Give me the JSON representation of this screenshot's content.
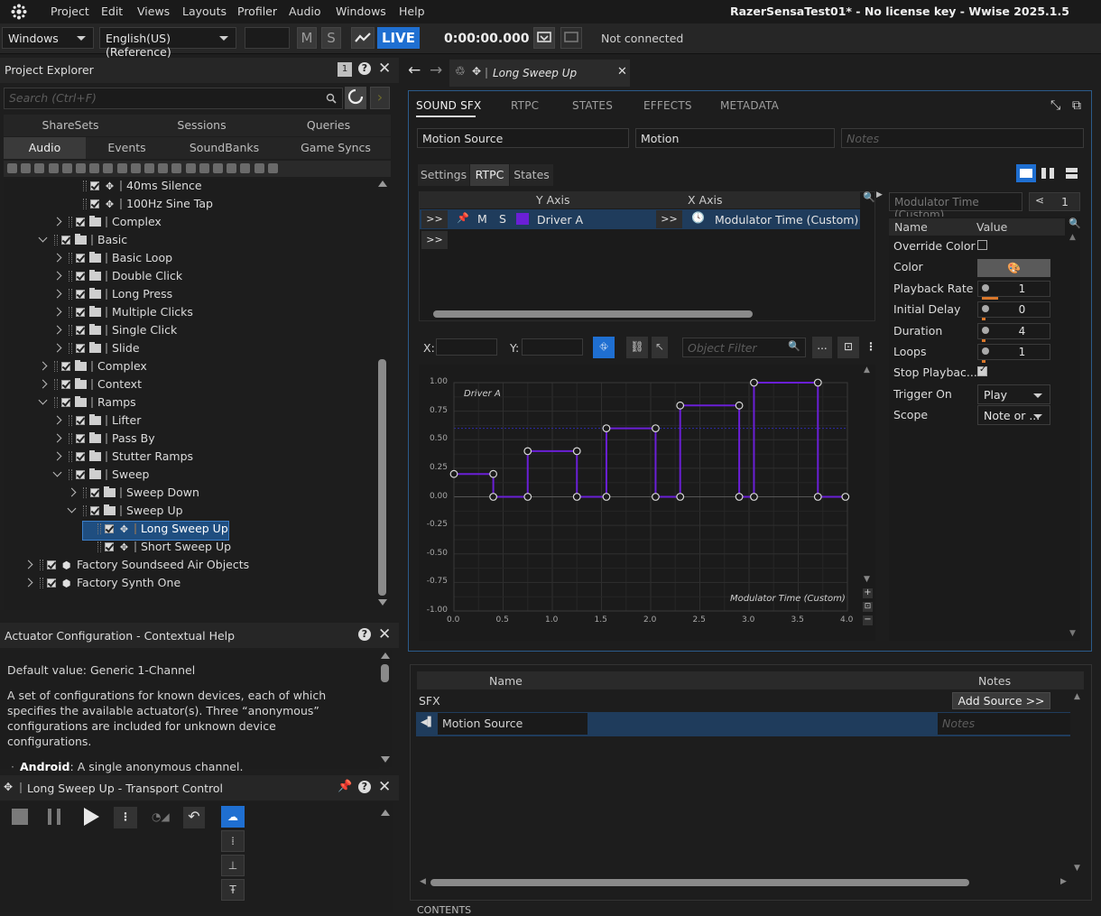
{
  "menu": {
    "items": [
      "Project",
      "Edit",
      "Views",
      "Layouts",
      "Profiler",
      "Audio",
      "Windows",
      "Help"
    ],
    "window_title": "RazerSensaTest01* - No license key - Wwise 2025.1.5"
  },
  "toolbar": {
    "platform": "Windows",
    "language": "English(US) (Reference)",
    "mute_label": "M",
    "solo_label": "S",
    "live_label": "LIVE",
    "time": "0:00:00.000",
    "connection_status": "Not connected"
  },
  "project_explorer": {
    "title": "Project Explorer",
    "badge": "1",
    "search_placeholder": "Search (Ctrl+F)",
    "tabs_top": [
      "ShareSets",
      "Sessions",
      "Queries"
    ],
    "tabs_bottom": [
      "Audio",
      "Events",
      "SoundBanks",
      "Game Syncs"
    ],
    "tree": [
      {
        "label": "40ms Silence",
        "kind": "sfx",
        "indent": 3,
        "expander": ""
      },
      {
        "label": "100Hz Sine Tap",
        "kind": "sfx",
        "indent": 3,
        "expander": ""
      },
      {
        "label": "Complex",
        "kind": "folder",
        "indent": 2,
        "expander": "right"
      },
      {
        "label": "Basic",
        "kind": "folder",
        "indent": 1,
        "expander": "down"
      },
      {
        "label": "Basic Loop",
        "kind": "folder",
        "indent": 2,
        "expander": "right"
      },
      {
        "label": "Double Click",
        "kind": "folder",
        "indent": 2,
        "expander": "right"
      },
      {
        "label": "Long Press",
        "kind": "folder",
        "indent": 2,
        "expander": "right"
      },
      {
        "label": "Multiple Clicks",
        "kind": "folder",
        "indent": 2,
        "expander": "right"
      },
      {
        "label": "Single Click",
        "kind": "folder",
        "indent": 2,
        "expander": "right"
      },
      {
        "label": "Slide",
        "kind": "folder",
        "indent": 2,
        "expander": "right"
      },
      {
        "label": "Complex",
        "kind": "folder",
        "indent": 1,
        "expander": "right"
      },
      {
        "label": "Context",
        "kind": "folder",
        "indent": 1,
        "expander": "right"
      },
      {
        "label": "Ramps",
        "kind": "folder",
        "indent": 1,
        "expander": "down"
      },
      {
        "label": "Lifter",
        "kind": "folder",
        "indent": 2,
        "expander": "right"
      },
      {
        "label": "Pass By",
        "kind": "folder",
        "indent": 2,
        "expander": "right"
      },
      {
        "label": "Stutter Ramps",
        "kind": "folder",
        "indent": 2,
        "expander": "right"
      },
      {
        "label": "Sweep",
        "kind": "folder",
        "indent": 2,
        "expander": "down"
      },
      {
        "label": "Sweep Down",
        "kind": "folder",
        "indent": 3,
        "expander": "right"
      },
      {
        "label": "Sweep Up",
        "kind": "folder",
        "indent": 3,
        "expander": "down"
      },
      {
        "label": "Long Sweep Up",
        "kind": "sfx",
        "indent": 4,
        "expander": "",
        "selected": true
      },
      {
        "label": "Short Sweep Up",
        "kind": "sfx",
        "indent": 4,
        "expander": ""
      },
      {
        "label": "Factory Soundseed Air Objects",
        "kind": "package",
        "indent": 0,
        "expander": "right"
      },
      {
        "label": "Factory Synth One",
        "kind": "package",
        "indent": 0,
        "expander": "right"
      }
    ]
  },
  "help_panel": {
    "title": "Actuator Configuration - Contextual Help",
    "default_value": "Default value: Generic 1-Channel",
    "description": "A set of configurations for known devices, each of which specifies the available actuator(s). Three “anonymous” configurations are included for unknown device configurations.",
    "bullet_term": "Android",
    "bullet_text": ": A single anonymous channel."
  },
  "transport": {
    "title": "Long Sweep Up - Transport Control"
  },
  "editor": {
    "tab_title": "Long Sweep Up",
    "tabs": [
      "SOUND SFX",
      "RTPC",
      "STATES",
      "EFFECTS",
      "METADATA"
    ],
    "name_value": "Motion Source",
    "type_value": "Motion",
    "notes_placeholder": "Notes",
    "subtabs": [
      "Settings",
      "RTPC",
      "States"
    ],
    "rtpc_headers": {
      "y_axis": "Y Axis",
      "x_axis": "X Axis"
    },
    "rtpc_row": {
      "expand": ">>",
      "m": "M",
      "s": "S",
      "y_value": "Driver A",
      "x_expand": ">>",
      "x_value": "Modulator Time (Custom)"
    },
    "rtpc_row2_expand": ">>",
    "x_label": "X:",
    "y_label": "Y:",
    "object_filter_placeholder": "Object Filter",
    "more_label": "...",
    "modulator_field": "Modulator Time (Custom)",
    "count": "1",
    "props_header": {
      "name": "Name",
      "value": "Value"
    },
    "props": [
      {
        "name": "Override Color",
        "type": "check",
        "checked": false
      },
      {
        "name": "Color",
        "type": "color"
      },
      {
        "name": "Playback Rate",
        "type": "slider",
        "value": "1"
      },
      {
        "name": "Initial Delay",
        "type": "slider",
        "value": "0"
      },
      {
        "name": "Duration",
        "type": "slider",
        "value": "4"
      },
      {
        "name": "Loops",
        "type": "slider",
        "value": "1"
      },
      {
        "name": "Stop Playbac...",
        "type": "check",
        "checked": true
      },
      {
        "name": "Trigger On",
        "type": "combo",
        "value": "Play"
      },
      {
        "name": "Scope",
        "type": "combo",
        "value": "Note or ..."
      }
    ]
  },
  "chart_data": {
    "type": "line",
    "title": "",
    "series": [
      {
        "name": "Driver A",
        "x": [
          0,
          0.4,
          0.4,
          0.75,
          0.75,
          1.25,
          1.25,
          1.55,
          1.55,
          2.05,
          2.05,
          2.3,
          2.3,
          2.9,
          2.9,
          3.05,
          3.05,
          3.7,
          3.7,
          3.98
        ],
        "y": [
          0.2,
          0.2,
          0,
          0,
          0.4,
          0.4,
          0,
          0,
          0.6,
          0.6,
          0,
          0,
          0.8,
          0.8,
          0,
          0,
          1,
          1,
          0,
          0
        ]
      }
    ],
    "series_label": "Driver A",
    "xlabel": "Modulator Time (Custom)",
    "x_ticks": [
      "0.0",
      "0.5",
      "1.0",
      "1.5",
      "2.0",
      "2.5",
      "3.0",
      "3.5",
      "4.0"
    ],
    "y_ticks": [
      "1.00",
      "0.75",
      "0.50",
      "0.25",
      "0.00",
      "-0.25",
      "-0.50",
      "-0.75",
      "-1.00"
    ],
    "xlim": [
      0,
      4
    ],
    "ylim": [
      -1,
      1
    ],
    "line_color": "#6a1fd6"
  },
  "contents": {
    "headers": {
      "name": "Name",
      "notes": "Notes"
    },
    "group": "SFX",
    "add_source": "Add Source >>",
    "item": "Motion Source",
    "item_notes_placeholder": "Notes",
    "footer_title": "CONTENTS"
  }
}
